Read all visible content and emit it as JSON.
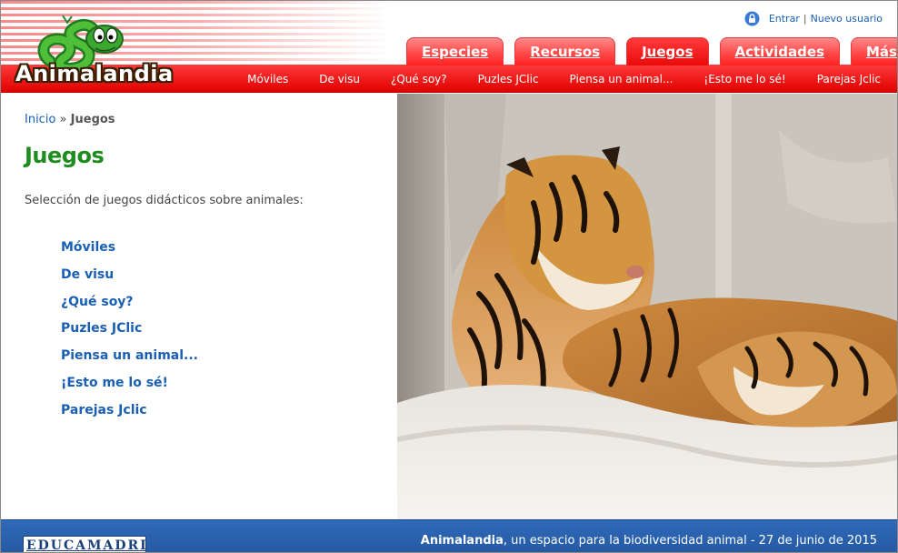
{
  "brand": {
    "name": "Animalandia"
  },
  "user_links": {
    "login": "Entrar",
    "separator": "|",
    "register": "Nuevo usuario"
  },
  "main_tabs": [
    {
      "label": "Especies"
    },
    {
      "label": "Recursos"
    },
    {
      "label": "Juegos",
      "active": true
    },
    {
      "label": "Actividades"
    },
    {
      "label": "Más..."
    }
  ],
  "sub_nav": [
    {
      "label": "Móviles"
    },
    {
      "label": "De visu"
    },
    {
      "label": "¿Qué soy?"
    },
    {
      "label": "Puzles JClic"
    },
    {
      "label": "Piensa un animal..."
    },
    {
      "label": "¡Esto me lo sé!"
    },
    {
      "label": "Parejas Jclic"
    }
  ],
  "breadcrumb": {
    "home": "Inicio",
    "separator": "»",
    "current": "Juegos"
  },
  "page": {
    "title": "Juegos",
    "intro": "Selección de juegos didácticos sobre animales:"
  },
  "games": [
    {
      "label": "Móviles"
    },
    {
      "label": "De visu"
    },
    {
      "label": "¿Qué soy?"
    },
    {
      "label": "Puzles JClic"
    },
    {
      "label": "Piensa un animal..."
    },
    {
      "label": "¡Esto me lo sé!"
    },
    {
      "label": "Parejas Jclic"
    }
  ],
  "footer": {
    "site": "Animalandia",
    "tagline": ", un espacio para la biodiversidad animal - 27 de junio de 2015",
    "partner_logo": "EDUCAMADRID"
  },
  "colors": {
    "brand_red": "#e10000",
    "title_green": "#1e8c1e",
    "link_blue": "#1a5fb4",
    "footer_blue": "#2f69b8"
  }
}
